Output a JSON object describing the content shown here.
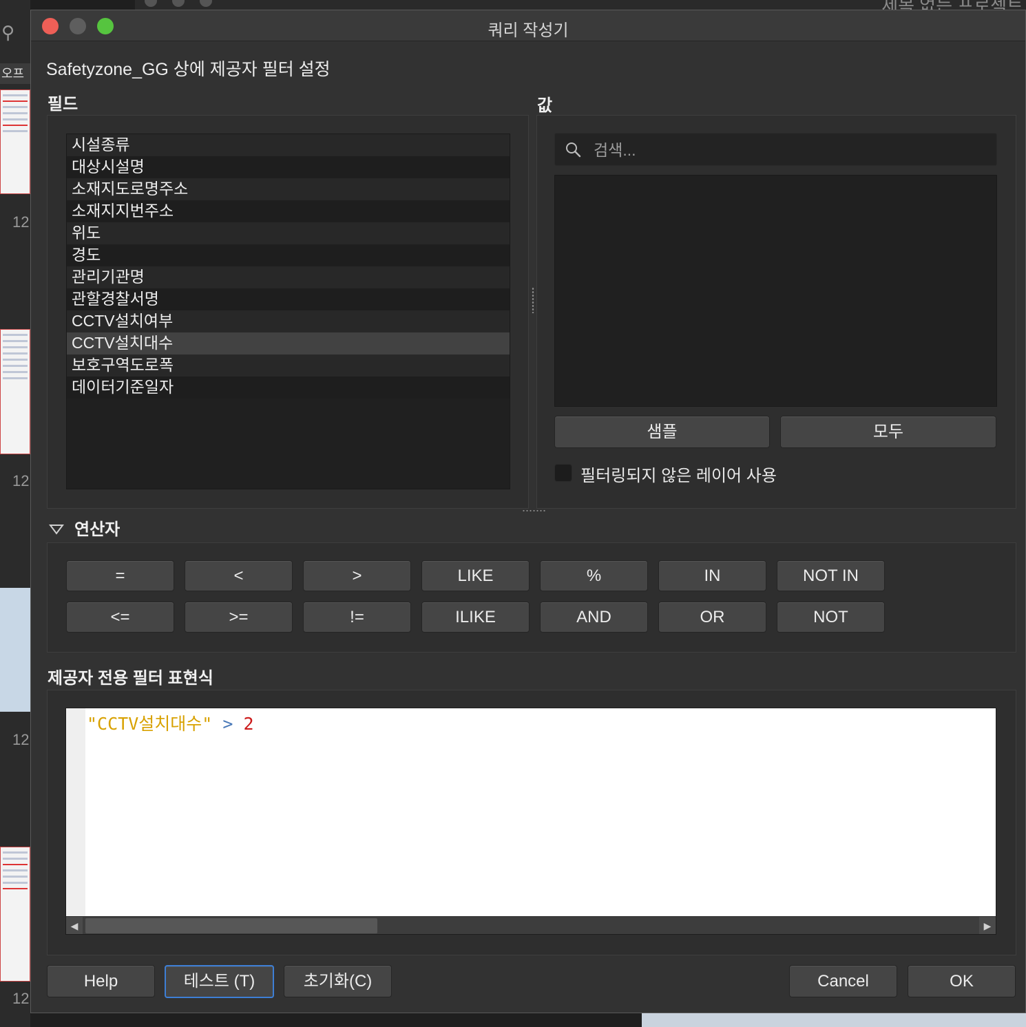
{
  "window": {
    "title": "쿼리 작성기"
  },
  "heading": "Safetyzone_GG 상에 제공자 필터 설정",
  "fields": {
    "label": "필드",
    "items": [
      "시설종류",
      "대상시설명",
      "소재지도로명주소",
      "소재지지번주소",
      "위도",
      "경도",
      "관리기관명",
      "관할경찰서명",
      "CCTV설치여부",
      "CCTV설치대수",
      "보호구역도로폭",
      "데이터기준일자"
    ],
    "selected": "CCTV설치대수"
  },
  "values": {
    "label": "값",
    "search_placeholder": "검색...",
    "sample_button": "샘플",
    "all_button": "모두",
    "use_unfiltered_label": "필터링되지 않은 레이어 사용",
    "use_unfiltered_checked": false
  },
  "operators": {
    "label": "연산자",
    "expanded": true,
    "row1": [
      "=",
      "<",
      ">",
      "LIKE",
      "%",
      "IN",
      "NOT IN"
    ],
    "row2": [
      "<=",
      ">=",
      "!=",
      "ILIKE",
      "AND",
      "OR",
      "NOT"
    ]
  },
  "expression": {
    "label": "제공자 전용 필터 표현식",
    "field_token": "\"CCTV설치대수\"",
    "operator_token": ">",
    "value_token": "2"
  },
  "buttons": {
    "help": "Help",
    "test": "테스트 (T)",
    "reset": "초기화(C)",
    "cancel": "Cancel",
    "ok": "OK"
  },
  "background": {
    "sidebar_tab": "오프",
    "slide_numbers": [
      "12",
      "12",
      "12",
      "12"
    ],
    "top_right_text": "제목 없는 프로젝트"
  },
  "colors": {
    "dialog_bg": "#323232",
    "string_token": "#d8a100",
    "operator_token": "#4a79b8",
    "number_token": "#cc1a1a",
    "focus_ring": "#3d7fd6"
  }
}
